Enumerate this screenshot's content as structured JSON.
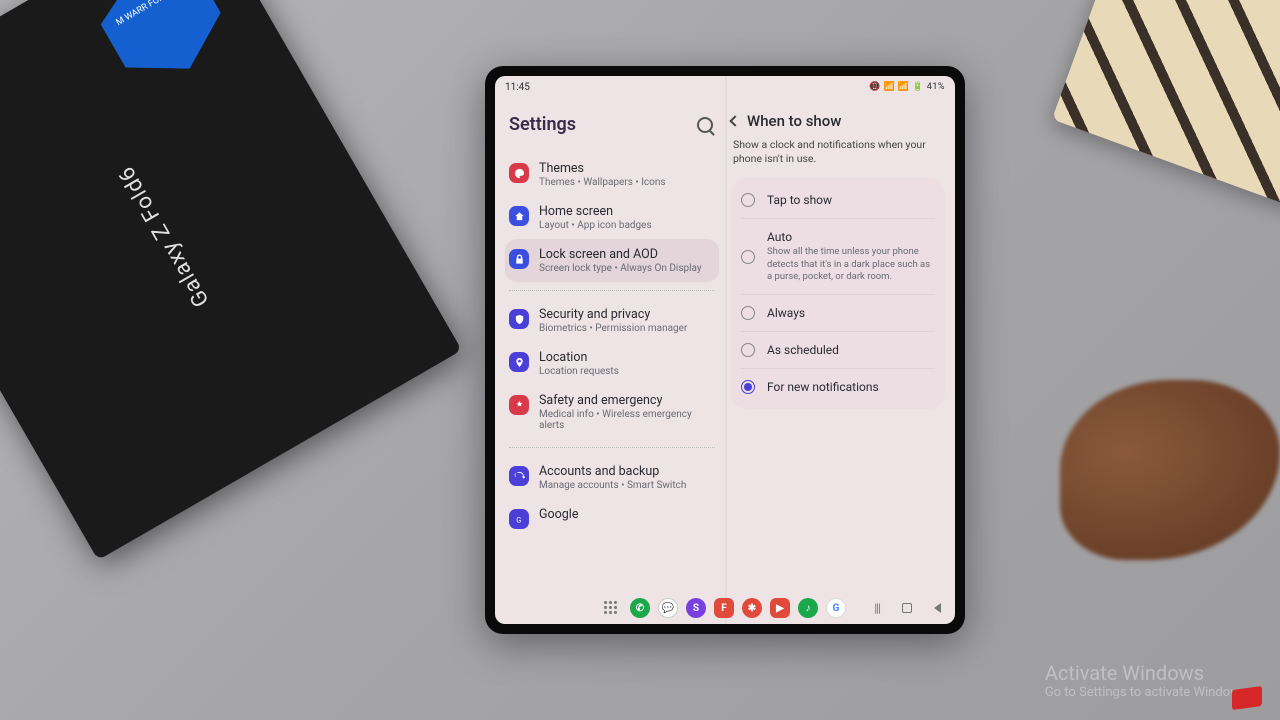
{
  "env": {
    "box_label": "Galaxy Z Fold6",
    "badge_text": "M WARR FOR AFRIC",
    "watermark_title": "Activate Windows",
    "watermark_sub": "Go to Settings to activate Windows."
  },
  "status": {
    "time": "11:45",
    "right": "📵 📶 📶 🔋 41%"
  },
  "sidebar": {
    "title": "Settings",
    "items": [
      {
        "title": "Themes",
        "sub": "Themes • Wallpapers • Icons",
        "color": "#d93a4a"
      },
      {
        "title": "Home screen",
        "sub": "Layout • App icon badges",
        "color": "#3a4fe0"
      },
      {
        "title": "Lock screen and AOD",
        "sub": "Screen lock type • Always On Display",
        "color": "#3a4fe0",
        "selected": true
      },
      {
        "title": "Security and privacy",
        "sub": "Biometrics • Permission manager",
        "color": "#4a3fd6"
      },
      {
        "title": "Location",
        "sub": "Location requests",
        "color": "#4a3fd6"
      },
      {
        "title": "Safety and emergency",
        "sub": "Medical info • Wireless emergency alerts",
        "color": "#d93a4a"
      },
      {
        "title": "Accounts and backup",
        "sub": "Manage accounts • Smart Switch",
        "color": "#4a3fd6"
      },
      {
        "title": "Google",
        "sub": "",
        "color": "#4a3fd6"
      }
    ]
  },
  "detail": {
    "title": "When to show",
    "desc": "Show a clock and notifications when your phone isn't in use.",
    "options": [
      {
        "label": "Tap to show"
      },
      {
        "label": "Auto",
        "sub": "Show all the time unless your phone detects that it's in a dark place such as a purse, pocket, or dark room."
      },
      {
        "label": "Always"
      },
      {
        "label": "As scheduled"
      },
      {
        "label": "For new notifications",
        "checked": true
      }
    ]
  },
  "taskbar": {
    "apps": [
      {
        "bg": "#1aa84a",
        "char": "📞"
      },
      {
        "bg": "#ffffff",
        "char": "💬",
        "ring": "#3a4fe0"
      },
      {
        "bg": "#7a3fe0",
        "char": "S"
      },
      {
        "bg": "#e04a3a",
        "char": "F"
      },
      {
        "bg": "#e04a3a",
        "char": "✱"
      },
      {
        "bg": "#e04a3a",
        "char": "▶"
      },
      {
        "bg": "#1aa84a",
        "char": "♪"
      },
      {
        "bg": "#ffffff",
        "char": "G",
        "multi": true
      }
    ]
  }
}
